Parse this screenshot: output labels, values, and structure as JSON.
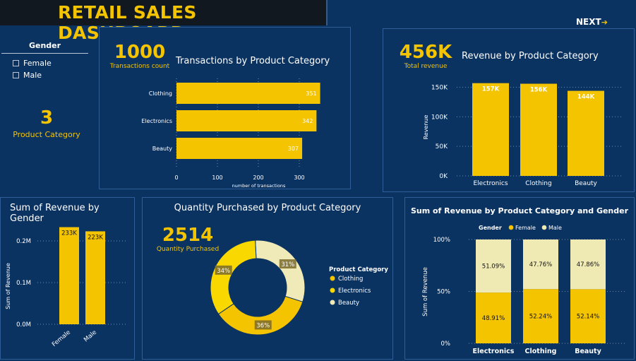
{
  "header": {
    "title": "RETAIL SALES DASHBOARD",
    "next_label": "NEXT"
  },
  "filter": {
    "title": "Gender",
    "options": [
      "Female",
      "Male"
    ]
  },
  "kpi_category": {
    "value": "3",
    "label": "Product Category"
  },
  "transactions": {
    "kpi_value": "1000",
    "kpi_label": "Transactions count",
    "title": "Transactions by Product Category"
  },
  "revenue_category": {
    "kpi_value": "456K",
    "kpi_label": "Total revenue",
    "title": "Revenue by Product Category"
  },
  "gender_revenue": {
    "title": "Sum of Revenue by Gender"
  },
  "quantity": {
    "title": "Quantity Purchased by Product Category",
    "kpi_value": "2514",
    "kpi_label": "Quantity Purchased",
    "legend_title": "Product Category"
  },
  "stacked": {
    "title": "Sum of Revenue by Product Category and Gender",
    "legend_title": "Gender",
    "legend_items": [
      "Female",
      "Male"
    ]
  },
  "colors": {
    "background": "#0b3362",
    "accent": "#f5c400",
    "clothing": "#f5c400",
    "electronics": "#f9d800",
    "beauty": "#f0eab8",
    "male": "#efe9b4"
  },
  "chart_data": [
    {
      "type": "bar",
      "orientation": "horizontal",
      "title": "Transactions by Product Category",
      "categories": [
        "Clothing",
        "Electronics",
        "Beauty"
      ],
      "values": [
        351,
        342,
        307
      ],
      "xlabel": "number of transactions",
      "ylabel": "",
      "xlim": [
        0,
        350
      ],
      "xticks": [
        "0",
        "100",
        "200",
        "300"
      ],
      "grid": true
    },
    {
      "type": "bar",
      "title": "Revenue by Product Category",
      "categories": [
        "Electronics",
        "Clothing",
        "Beauty"
      ],
      "values": [
        157000,
        156000,
        144000
      ],
      "data_labels": [
        "157K",
        "156K",
        "144K"
      ],
      "xlabel": "",
      "ylabel": "Revenue",
      "ylim": [
        0,
        165000
      ],
      "yticks": [
        "0K",
        "50K",
        "100K",
        "150K"
      ],
      "grid": true
    },
    {
      "type": "bar",
      "title": "Sum of Revenue by Gender",
      "categories": [
        "Female",
        "Male"
      ],
      "values": [
        233000,
        223000
      ],
      "data_labels": [
        "233K",
        "223K"
      ],
      "xlabel": "",
      "ylabel": "Sum of Revenue",
      "ylim": [
        0,
        240000
      ],
      "yticks": [
        "0.0M",
        "0.1M",
        "0.2M"
      ],
      "grid": true
    },
    {
      "type": "pie",
      "style": "donut",
      "title": "Quantity Purchased by Product Category",
      "categories": [
        "Clothing",
        "Electronics",
        "Beauty"
      ],
      "values": [
        36,
        34,
        31
      ],
      "data_labels": [
        "36%",
        "34%",
        "31%"
      ],
      "legend": "right"
    },
    {
      "type": "bar",
      "stacked": "100%",
      "title": "Sum of Revenue by Product Category and Gender",
      "categories": [
        "Electronics",
        "Clothing",
        "Beauty"
      ],
      "series": [
        {
          "name": "Female",
          "values": [
            48.91,
            52.24,
            52.14
          ],
          "data_labels": [
            "48.91%",
            "52.24%",
            "52.14%"
          ]
        },
        {
          "name": "Male",
          "values": [
            51.09,
            47.76,
            47.86
          ],
          "data_labels": [
            "51.09%",
            "47.76%",
            "47.86%"
          ]
        }
      ],
      "ylabel": "Sum of Revenue",
      "ylim": [
        0,
        100
      ],
      "yticks": [
        "0%",
        "50%",
        "100%"
      ],
      "legend": "top-left",
      "grid": true
    }
  ]
}
